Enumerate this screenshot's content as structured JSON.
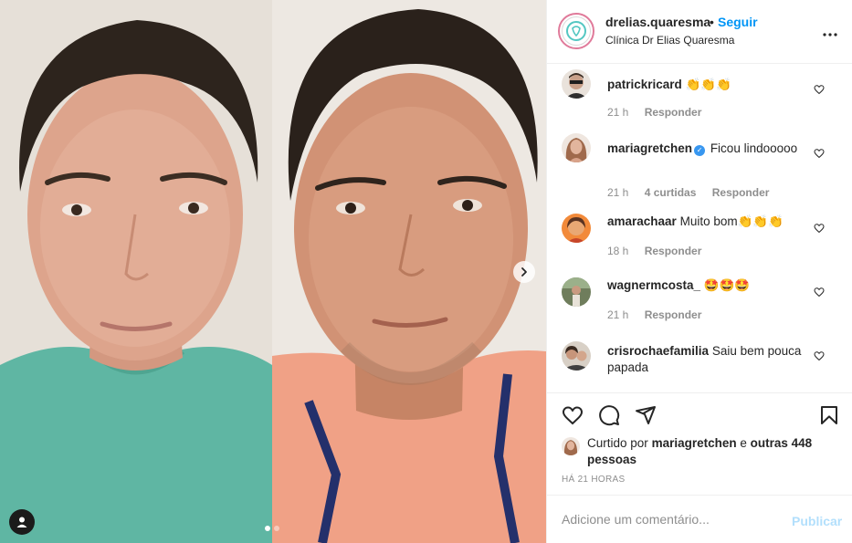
{
  "post": {
    "author": "drelias.quaresma",
    "separator": "•",
    "follow_label": "Seguir",
    "location": "Clínica Dr Elias Quaresma",
    "more_icon": "more-icon"
  },
  "media": {
    "slide_count": 2,
    "active_slide": 1,
    "next_icon": "chevron-right-icon",
    "tags_icon": "user-tag-icon"
  },
  "comments": [
    {
      "user": "patrickricard",
      "text": "👏👏👏",
      "verified": false,
      "time": "21 h",
      "replies": "",
      "reply_label": "Responder",
      "avatar_color": "#6b5b4e"
    },
    {
      "user": "mariagretchen",
      "text": "Ficou lindooooo",
      "verified": true,
      "time": "21 h",
      "replies": "4 curtidas",
      "reply_label": "Responder",
      "avatar_color": "#c79a85"
    },
    {
      "user": "amarachaar",
      "text": "Muito bom👏👏👏",
      "verified": false,
      "time": "18 h",
      "replies": "",
      "reply_label": "Responder",
      "avatar_color": "#d96b2b"
    },
    {
      "user": "wagnermcosta_",
      "text": "🤩🤩🤩",
      "verified": false,
      "time": "21 h",
      "replies": "",
      "reply_label": "Responder",
      "avatar_color": "#7d8f6a"
    },
    {
      "user": "crisrochaefamilia",
      "text": "Saiu bem pouca papada",
      "verified": false,
      "time": "",
      "replies": "",
      "reply_label": "",
      "avatar_color": "#8a7666"
    }
  ],
  "actions": {
    "like_icon": "heart-icon",
    "comment_icon": "comment-icon",
    "share_icon": "share-icon",
    "save_icon": "bookmark-icon"
  },
  "likes": {
    "prefix": "Curtido por",
    "user": "mariagretchen",
    "conj": "e",
    "others": "outras 448 pessoas"
  },
  "time_ago": "HÁ 21 HORAS",
  "add_comment": {
    "placeholder": "Adicione um comentário...",
    "publish_label": "Publicar"
  },
  "colors": {
    "accent": "#0095f6",
    "publish_disabled": "#b2dffc",
    "meta": "#8e8e8e"
  }
}
